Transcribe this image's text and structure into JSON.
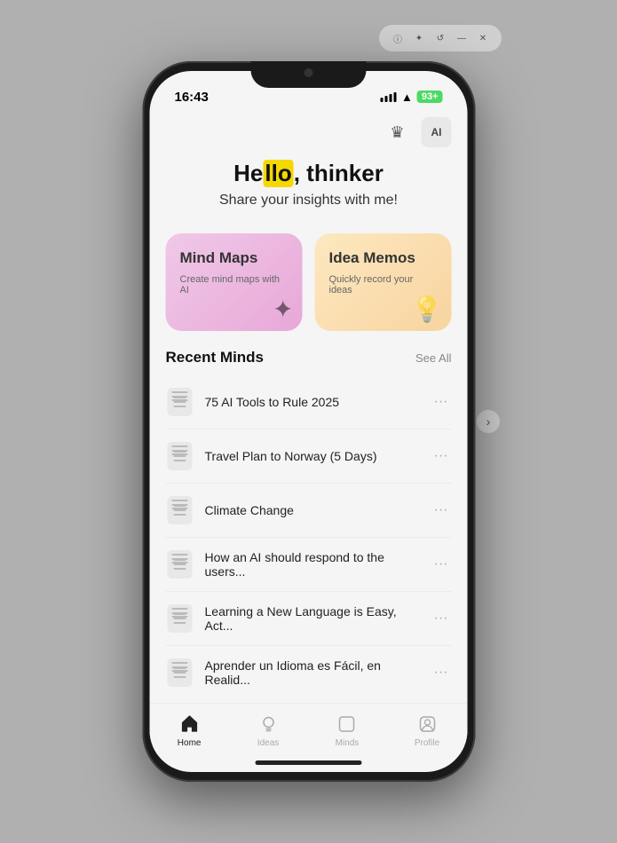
{
  "status_bar": {
    "time": "16:43",
    "battery": "93+"
  },
  "top_actions": {
    "crown_icon": "👑",
    "ai_label": "AI"
  },
  "greeting": {
    "hello": "He",
    "hello_highlighted": "llo",
    "rest": ", thinker",
    "subtitle": "Share your insights with me!"
  },
  "cards": [
    {
      "id": "mind-maps",
      "title": "Mind Maps",
      "subtitle": "Create mind maps with AI",
      "icon": "✦"
    },
    {
      "id": "idea-memos",
      "title": "Idea Memos",
      "subtitle": "Quickly record your ideas",
      "icon": "💡"
    }
  ],
  "recent_section": {
    "title": "Recent Minds",
    "see_all": "See All"
  },
  "list_items": [
    {
      "text": "75 AI Tools to Rule 2025"
    },
    {
      "text": "Travel Plan to Norway (5 Days)"
    },
    {
      "text": "Climate Change"
    },
    {
      "text": "How an AI should respond to the users..."
    },
    {
      "text": "Learning a New Language is Easy, Act..."
    },
    {
      "text": "Aprender un Idioma es Fácil, en Realid..."
    }
  ],
  "nav": {
    "items": [
      {
        "label": "Home",
        "icon": "⌂",
        "active": true
      },
      {
        "label": "Ideas",
        "icon": "○",
        "active": false
      },
      {
        "label": "Minds",
        "icon": "□",
        "active": false
      },
      {
        "label": "Profile",
        "icon": "◻",
        "active": false
      }
    ]
  }
}
